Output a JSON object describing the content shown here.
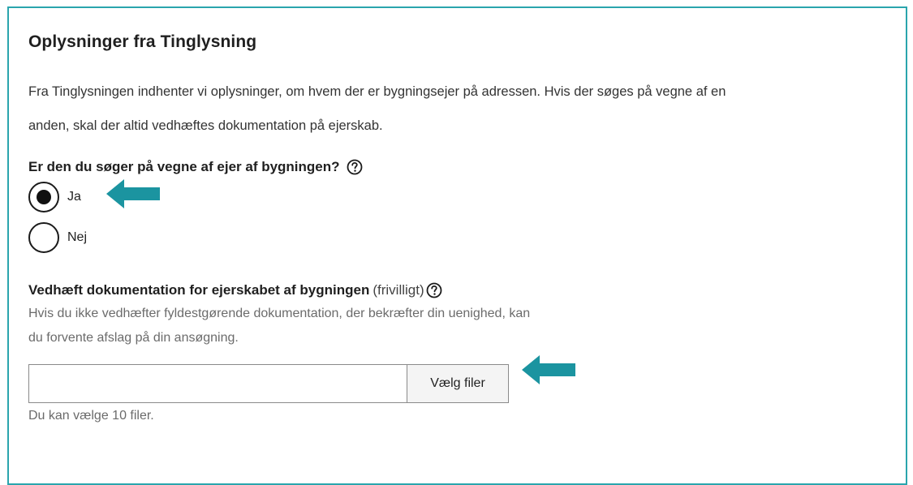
{
  "section": {
    "title": "Oplysninger fra Tinglysning",
    "intro_line1": "Fra Tinglysningen indhenter vi oplysninger, om hvem der er bygningsejer på adressen. Hvis der søges på vegne af en",
    "intro_line2": "anden, skal der altid vedhæftes dokumentation på ejerskab."
  },
  "ownership_question": {
    "label": "Er den du søger på vegne af ejer af bygningen?",
    "options": [
      {
        "label": "Ja",
        "checked": true
      },
      {
        "label": "Nej",
        "checked": false
      }
    ]
  },
  "attachment": {
    "label": "Vedhæft dokumentation for ejerskabet af bygningen",
    "optional": "(frivilligt)",
    "hint_line1": "Hvis du ikke vedhæfter fyldestgørende dokumentation, der bekræfter din uenighed, kan",
    "hint_line2": "du forvente afslag på din ansøgning.",
    "button_label": "Vælg filer",
    "file_note": "Du kan vælge 10 filer."
  },
  "colors": {
    "accent": "#2aa5ad",
    "arrow": "#1b94a0"
  },
  "icons": {
    "help": "question-circle-icon",
    "pointer": "arrow-left-icon"
  }
}
